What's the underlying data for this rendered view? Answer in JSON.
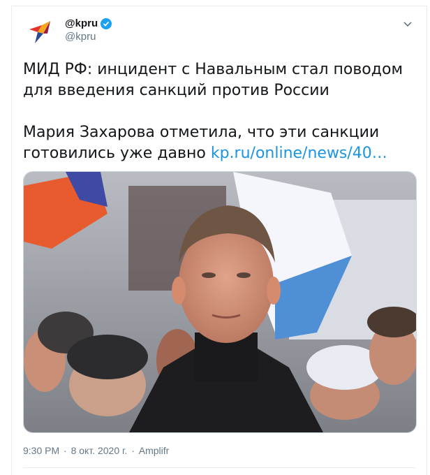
{
  "tweet": {
    "display_name": "@kpru",
    "handle": "@kpru",
    "text_line1": "МИД РФ: инцидент с Навальным стал поводом для введения санкций против России",
    "text_line2": "Мария Захарова отметила, что эти санкции готовились уже давно ",
    "link_text": "kp.ru/online/news/40…",
    "time": "9:30 PM",
    "date": "8 окт. 2020 г.",
    "separator": "·",
    "source": "Amplifr"
  },
  "colors": {
    "link": "#1b95e0",
    "verified": "#1da1f2",
    "muted": "#657786"
  },
  "icons": {
    "verified": "verified-badge-icon",
    "caret": "chevron-down-icon",
    "avatar": "kp-logo-bird"
  }
}
